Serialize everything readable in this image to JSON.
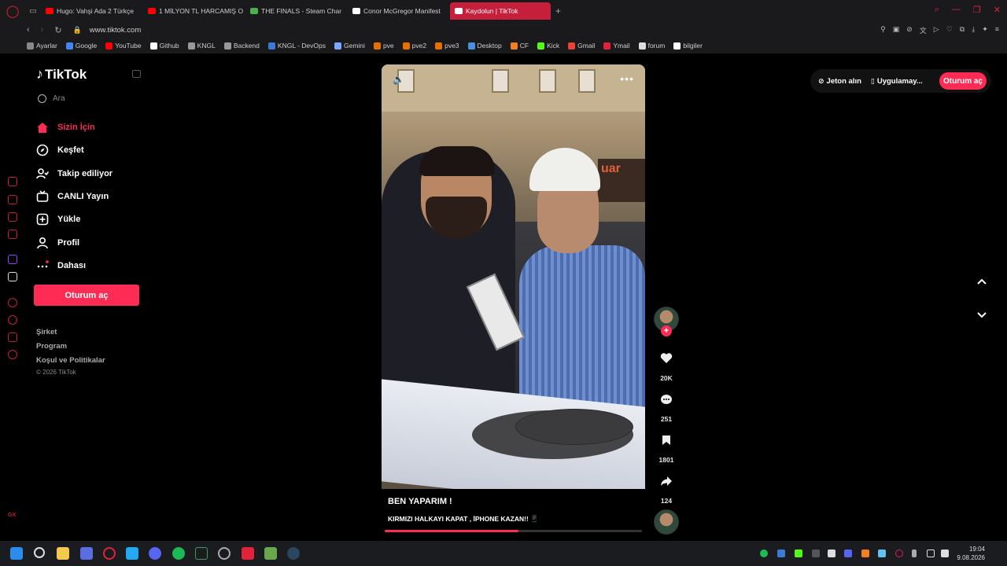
{
  "browser": {
    "tabs": [
      {
        "label": "Hugo: Vahşi Ada 2 Türkçe",
        "color": "#ff0000"
      },
      {
        "label": "1 MİLYON TL HARCAMIŞ O",
        "color": "#ff0000"
      },
      {
        "label": "THE FINALS - Steam Char",
        "color": "#4caf50"
      },
      {
        "label": "Conor McGregor Manifest",
        "color": "#ffffff"
      },
      {
        "label": "Kaydolun | TikTok",
        "color": "#ffffff",
        "active": true
      }
    ],
    "url": "www.tiktok.com",
    "bookmarks": [
      {
        "label": "Ayarlar",
        "color": "#888888"
      },
      {
        "label": "Google",
        "color": "#4285f4"
      },
      {
        "label": "YouTube",
        "color": "#ff0000"
      },
      {
        "label": "Github",
        "color": "#ffffff"
      },
      {
        "label": "KNGL",
        "color": "#999999"
      },
      {
        "label": "Backend",
        "color": "#999999"
      },
      {
        "label": "KNGL - DevOps",
        "color": "#3b7bd6"
      },
      {
        "label": "Gemini",
        "color": "#7aa7ff"
      },
      {
        "label": "pve",
        "color": "#e57000"
      },
      {
        "label": "pve2",
        "color": "#e57000"
      },
      {
        "label": "pve3",
        "color": "#e57000"
      },
      {
        "label": "Desktop",
        "color": "#4a90e2"
      },
      {
        "label": "CF",
        "color": "#f38020"
      },
      {
        "label": "Kick",
        "color": "#53fc18"
      },
      {
        "label": "Gmail",
        "color": "#ea4335"
      },
      {
        "label": "Ymail",
        "color": "#e0233b"
      },
      {
        "label": "forum",
        "color": "#dddddd"
      },
      {
        "label": "bilgiler",
        "color": "#ffffff"
      }
    ]
  },
  "tiktok": {
    "logo": "TikTok",
    "search_placeholder": "Ara",
    "nav": [
      {
        "label": "Sizin İçin",
        "icon": "home-icon",
        "active": true
      },
      {
        "label": "Keşfet",
        "icon": "compass-icon"
      },
      {
        "label": "Takip ediliyor",
        "icon": "following-icon"
      },
      {
        "label": "CANLI Yayın",
        "icon": "live-icon"
      },
      {
        "label": "Yükle",
        "icon": "upload-icon"
      },
      {
        "label": "Profil",
        "icon": "profile-icon"
      },
      {
        "label": "Dahası",
        "icon": "more-icon"
      }
    ],
    "login_button": "Oturum aç",
    "footer": {
      "company": "Şirket",
      "program": "Program",
      "terms": "Koşul ve Politikalar",
      "copyright": "© 2026 TikTok"
    },
    "top_right": {
      "coins": "Jeton alın",
      "app": "Uygulamay...",
      "login": "Oturum aç"
    },
    "video": {
      "title": "BEN YAPARIM !",
      "description": "KIRMIZI HALKAYI KAPAT , İPHONE KAZAN!! 📱",
      "sign_text": "uar",
      "progress": 0.52
    },
    "actions": {
      "likes": "20K",
      "comments": "251",
      "saves": "1801",
      "shares": "124"
    },
    "accent": "#fe2c55"
  },
  "taskbar": {
    "time": "19:04",
    "date": "9.08.2026"
  }
}
